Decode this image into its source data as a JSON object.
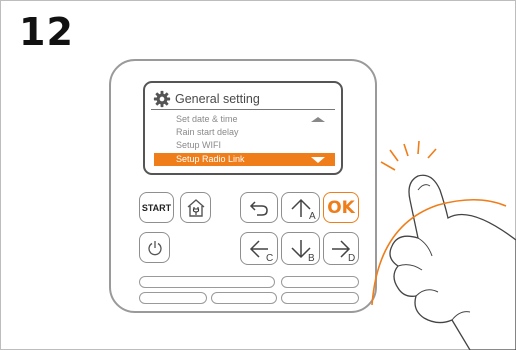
{
  "step_number": "12",
  "screen": {
    "title": "General setting",
    "items": [
      {
        "label": "Set date & time"
      },
      {
        "label": "Rain start delay"
      },
      {
        "label": "Setup WIFI"
      },
      {
        "label": "Setup Radio Link",
        "selected": true
      }
    ]
  },
  "buttons": {
    "start": "START",
    "ok": "OK",
    "up_letter": "A",
    "down_letter": "B",
    "left_letter": "C",
    "right_letter": "D"
  },
  "icons": {
    "settings": "gear-icon",
    "home": "home-plug-icon",
    "back": "back-arrow-icon",
    "power": "power-icon",
    "scroll_up": "triangle-up-icon",
    "scroll_down": "triangle-down-icon"
  },
  "colors": {
    "accent": "#ef7d1a",
    "outline": "#9a9a9a"
  }
}
